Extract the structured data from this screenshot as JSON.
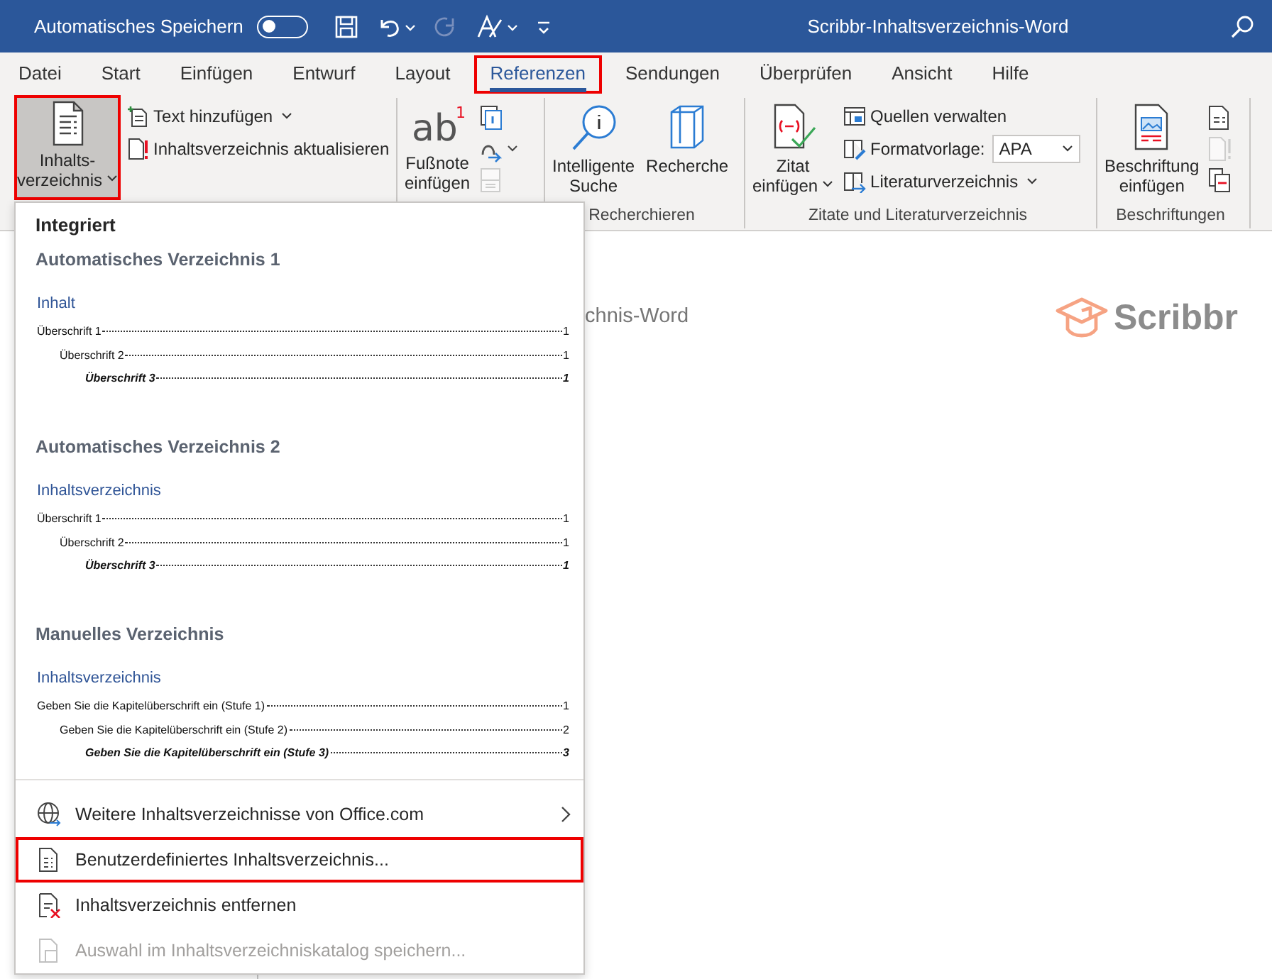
{
  "title_bar": {
    "autosave_label": "Automatisches Speichern",
    "autosave_on": false,
    "title": "Scribbr-Inhaltsverzeichnis-Word"
  },
  "tabs": [
    {
      "label": "Datei",
      "selected": false,
      "highlighted": false
    },
    {
      "label": "Start",
      "selected": false,
      "highlighted": false
    },
    {
      "label": "Einfügen",
      "selected": false,
      "highlighted": false
    },
    {
      "label": "Entwurf",
      "selected": false,
      "highlighted": false
    },
    {
      "label": "Layout",
      "selected": false,
      "highlighted": false
    },
    {
      "label": "Referenzen",
      "selected": true,
      "highlighted": true
    },
    {
      "label": "Sendungen",
      "selected": false,
      "highlighted": false
    },
    {
      "label": "Überprüfen",
      "selected": false,
      "highlighted": false
    },
    {
      "label": "Ansicht",
      "selected": false,
      "highlighted": false
    },
    {
      "label": "Hilfe",
      "selected": false,
      "highlighted": false
    }
  ],
  "ribbon": {
    "toc": {
      "button": {
        "lines": [
          "Inhalts-",
          "verzeichnis"
        ],
        "pressed": true,
        "highlighted": true
      },
      "add_text": "Text hinzufügen",
      "update": "Inhaltsverzeichnis aktualisieren"
    },
    "footnotes": {
      "button": {
        "lines": [
          "Fußnote",
          "einfügen"
        ]
      },
      "icon_text": "ab",
      "icon_superscript": "1",
      "tools": [
        {
          "disabled": false
        },
        {
          "disabled": false
        },
        {
          "disabled": true
        }
      ]
    },
    "research": {
      "label": "Recherchieren",
      "smart_search": [
        "Intelligente",
        "Suche"
      ],
      "researcher": [
        "Recherche"
      ]
    },
    "citations": {
      "label": "Zitate und Literaturverzeichnis",
      "insert": [
        "Zitat",
        "einfügen"
      ],
      "manage": "Quellen verwalten",
      "style_label": "Formatvorlage:",
      "style_value": "APA",
      "bibliography": "Literaturverzeichnis"
    },
    "captions": {
      "label": "Beschriftungen",
      "insert": [
        "Beschriftung",
        "einfügen"
      ],
      "tools": [
        {
          "disabled": false
        },
        {
          "disabled": true
        },
        {
          "disabled": false
        }
      ]
    }
  },
  "menu": {
    "heading": "Integriert",
    "gallery": [
      {
        "title": "Automatisches Verzeichnis 1",
        "toc_heading": "Inhalt",
        "entries": [
          {
            "text": "Überschrift 1",
            "page": "1",
            "children": [
              {
                "text": "Überschrift 2",
                "page": "1",
                "children": [
                  {
                    "text": "Überschrift 3",
                    "page": "1"
                  }
                ]
              }
            ]
          }
        ]
      },
      {
        "title": "Automatisches Verzeichnis 2",
        "toc_heading": "Inhaltsverzeichnis",
        "entries": [
          {
            "text": "Überschrift 1",
            "page": "1",
            "children": [
              {
                "text": "Überschrift 2",
                "page": "1",
                "children": [
                  {
                    "text": "Überschrift 3",
                    "page": "1"
                  }
                ]
              }
            ]
          }
        ]
      },
      {
        "title": "Manuelles Verzeichnis",
        "toc_heading": "Inhaltsverzeichnis",
        "entries": [
          {
            "text": "Geben Sie die Kapitelüberschrift ein (Stufe 1)",
            "page": "1",
            "children": [
              {
                "text": "Geben Sie die Kapitelüberschrift ein (Stufe 2)",
                "page": "2",
                "children": [
                  {
                    "text": "Geben Sie die Kapitelüberschrift ein (Stufe 3)",
                    "page": "3"
                  }
                ]
              }
            ]
          }
        ]
      }
    ],
    "commands": [
      {
        "label": "Weitere Inhaltsverzeichnisse von Office.com",
        "submenu": true,
        "disabled": false,
        "highlighted": false
      },
      {
        "label": "Benutzerdefiniertes Inhaltsverzeichnis...",
        "submenu": false,
        "disabled": false,
        "highlighted": true
      },
      {
        "label": "Inhaltsverzeichnis entfernen",
        "submenu": false,
        "disabled": false,
        "highlighted": false
      },
      {
        "label": "Auswahl im Inhaltsverzeichniskatalog speichern...",
        "submenu": false,
        "disabled": true,
        "highlighted": false
      }
    ]
  },
  "document": {
    "title_fragment": "chnis-Word",
    "logo": "Scribbr"
  }
}
